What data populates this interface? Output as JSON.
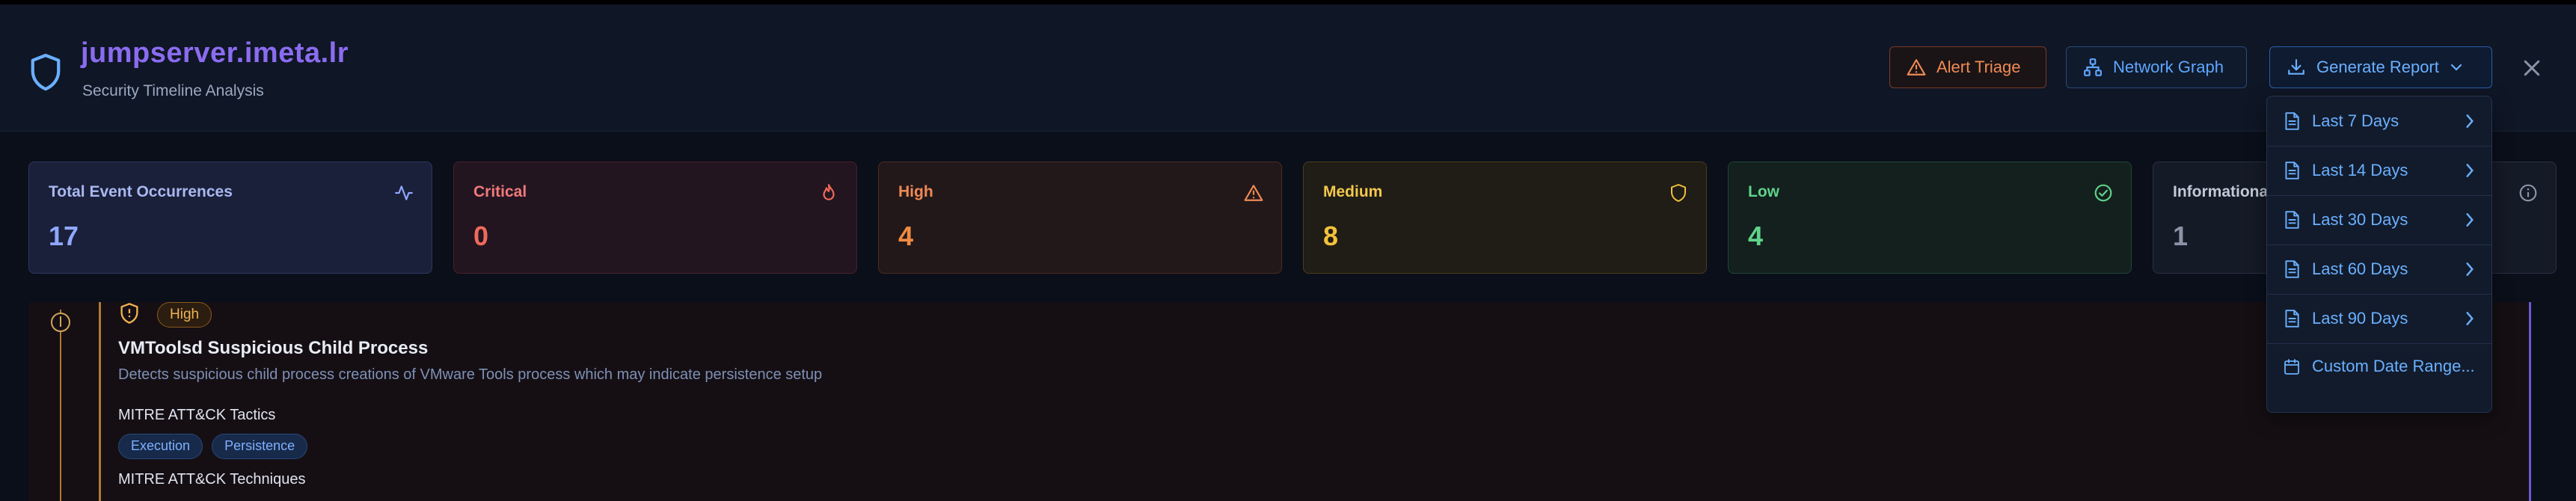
{
  "header": {
    "title": "jumpserver.imeta.lr",
    "subtitle": "Security Timeline Analysis",
    "buttons": {
      "alert_triage": "Alert Triage",
      "network_graph": "Network Graph",
      "generate_report": "Generate Report"
    }
  },
  "stats": [
    {
      "label": "Total Event Occurrences",
      "value": "17",
      "icon": "activity-icon"
    },
    {
      "label": "Critical",
      "value": "0",
      "icon": "flame-icon"
    },
    {
      "label": "High",
      "value": "4",
      "icon": "warning-triangle-icon"
    },
    {
      "label": "Medium",
      "value": "8",
      "icon": "shield-icon"
    },
    {
      "label": "Low",
      "value": "4",
      "icon": "check-circle-icon"
    },
    {
      "label": "Informational",
      "value": "1",
      "icon": "info-icon"
    }
  ],
  "report_menu": {
    "items": [
      "Last 7 Days",
      "Last 14 Days",
      "Last 30 Days",
      "Last 60 Days",
      "Last 90 Days"
    ],
    "custom": "Custom Date Range..."
  },
  "event": {
    "severity": "High",
    "title": "VMToolsd Suspicious Child Process",
    "description": "Detects suspicious child process creations of VMware Tools process which may indicate persistence setup",
    "tactics_heading": "MITRE ATT&CK Tactics",
    "tactics": [
      "Execution",
      "Persistence"
    ],
    "techniques_heading": "MITRE ATT&CK Techniques"
  },
  "colors": {
    "accent": "#6ab0ff",
    "title": "#8b6cf0",
    "critical": "#ef6a5a",
    "high": "#f08a40",
    "medium": "#f2c23a",
    "low": "#5fd38a"
  }
}
